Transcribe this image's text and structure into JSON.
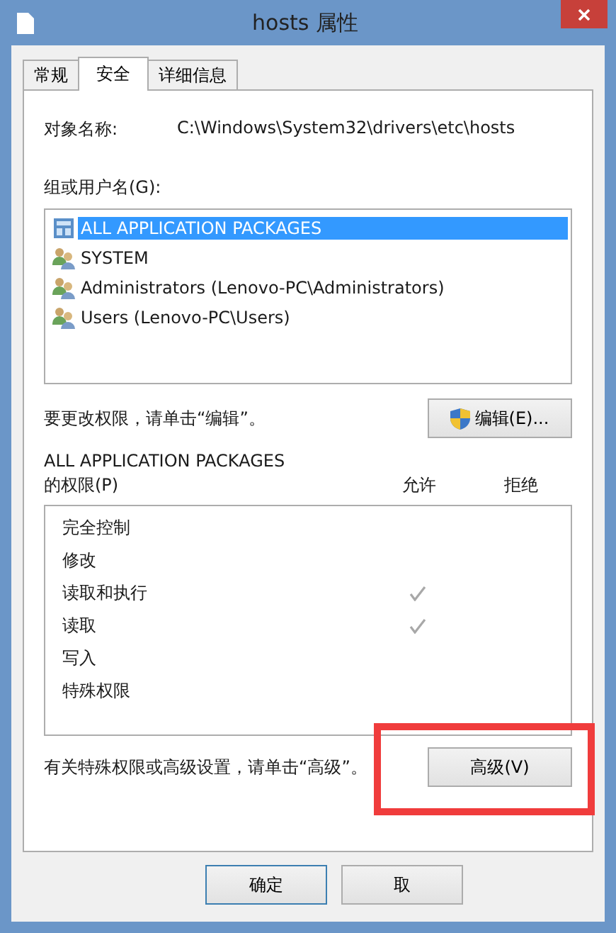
{
  "window": {
    "title": "hosts 属性"
  },
  "tabs": [
    {
      "label": "常规",
      "selected": false
    },
    {
      "label": "安全",
      "selected": true
    },
    {
      "label": "详细信息",
      "selected": false
    }
  ],
  "object_name": {
    "label": "对象名称:",
    "value": "C:\\Windows\\System32\\drivers\\etc\\hosts"
  },
  "groups": {
    "label": "组或用户名(G):",
    "items": [
      {
        "name": "ALL APPLICATION PACKAGES",
        "kind": "package",
        "selected": true
      },
      {
        "name": "SYSTEM",
        "kind": "group",
        "selected": false
      },
      {
        "name": "Administrators (Lenovo-PC\\Administrators)",
        "kind": "group",
        "selected": false
      },
      {
        "name": "Users (Lenovo-PC\\Users)",
        "kind": "group",
        "selected": false
      }
    ]
  },
  "edit_hint": "要更改权限，请单击“编辑”。",
  "edit_button": "编辑(E)...",
  "permissions": {
    "principal": "ALL APPLICATION PACKAGES",
    "label": "的权限(P)",
    "allow_header": "允许",
    "deny_header": "拒绝",
    "rows": [
      {
        "name": "完全控制",
        "allow": false,
        "deny": false
      },
      {
        "name": "修改",
        "allow": false,
        "deny": false
      },
      {
        "name": "读取和执行",
        "allow": true,
        "deny": false
      },
      {
        "name": "读取",
        "allow": true,
        "deny": false
      },
      {
        "name": "写入",
        "allow": false,
        "deny": false
      },
      {
        "name": "特殊权限",
        "allow": false,
        "deny": false
      }
    ]
  },
  "advanced_hint": "有关特殊权限或高级设置，请单击“高级”。",
  "advanced_button": "高级(V)",
  "buttons": [
    "确定",
    "取"
  ]
}
